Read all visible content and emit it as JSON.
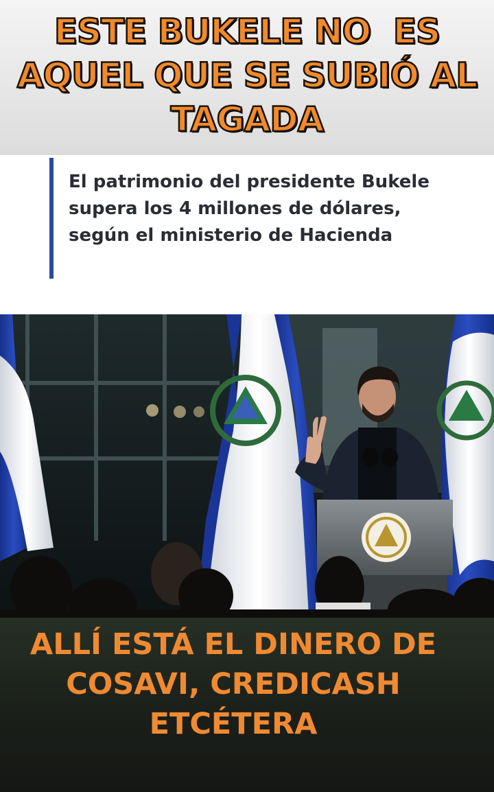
{
  "header": {
    "headline_lines": [
      "ESTE BUKELE NO  ES",
      "AQUEL QUE SE SUBIÓ AL",
      "TAGADA"
    ]
  },
  "quote": {
    "lines": [
      "El patrimonio del presidente Bukele",
      "supera los 4 millones de dólares,",
      "según el ministerio de Hacienda"
    ]
  },
  "photo": {
    "subject": "man-at-podium-peace-sign"
  },
  "footer": {
    "caption_lines": [
      "ALLÍ ESTÁ EL DINERO DE",
      "COSAVI, CREDICASH",
      "ETCÉTERA"
    ]
  },
  "colors": {
    "headline_orange": "#f08a2c",
    "quote_bar_blue": "#2b4a9a",
    "flag_blue": "#1f3fa0",
    "footer_bg": "#1b1f1a"
  }
}
